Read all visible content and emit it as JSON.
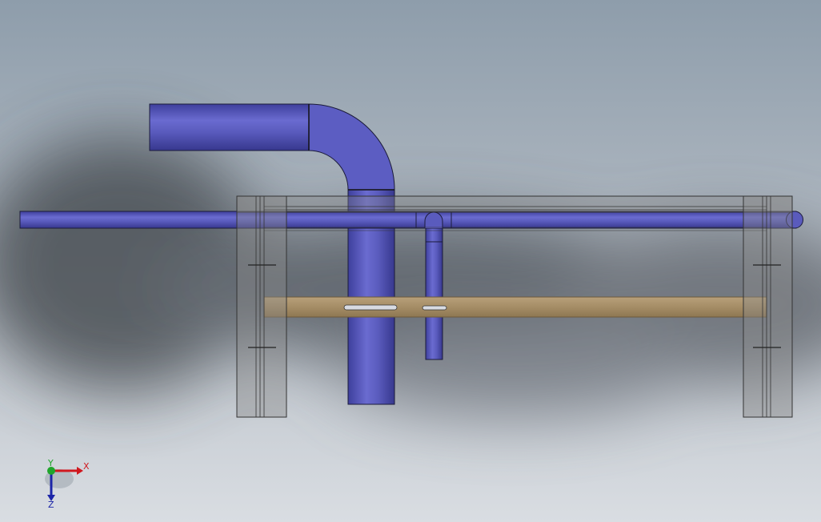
{
  "viewport": {
    "background_top": "#8e9dab",
    "background_bottom": "#d9dde2"
  },
  "model": {
    "pipe_color": "#5a5bbd",
    "beam_color": "#a58d66",
    "frame_color": "#7f7f7f",
    "clamp_color": "#d8dbe2"
  },
  "triad": {
    "x_label": "X",
    "y_label": "Y",
    "z_label": "Z",
    "x_color": "#d0181f",
    "y_color": "#1fa52b",
    "z_color": "#1c25a8"
  }
}
